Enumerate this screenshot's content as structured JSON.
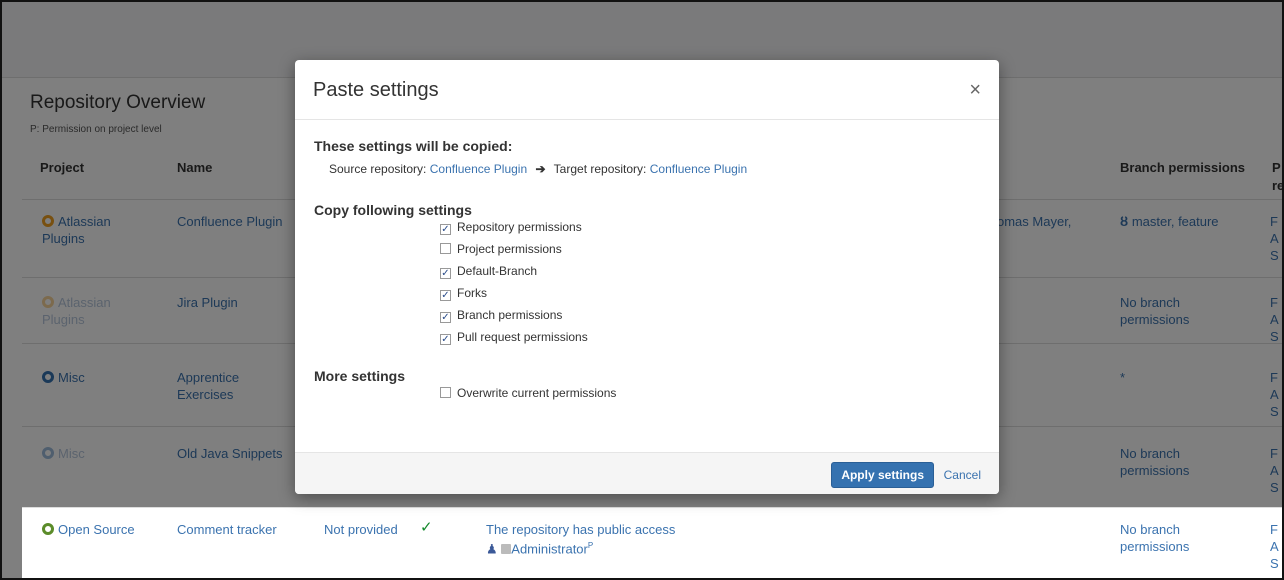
{
  "overview": {
    "title": "Repository Overview",
    "subtitle": "P: Permission on project level"
  },
  "table": {
    "headers": {
      "project": "Project",
      "name": "Name",
      "branch_permissions": "Branch permissions",
      "last_partial": "P",
      "last_partial2": "re"
    },
    "rows": [
      {
        "project": "Atlassian Plugins",
        "name": "Confluence Plugin",
        "users_partial": "omas Mayer,",
        "branch": "master, feature",
        "last": "F A S"
      },
      {
        "project": "Atlassian Plugins",
        "name": "Jira Plugin",
        "branch": "No branch permissions",
        "last": "F A S"
      },
      {
        "project": "Misc",
        "name": "Apprentice Exercises",
        "branch": "*",
        "last": "F A S"
      },
      {
        "project": "Misc",
        "name": "Old Java Snippets",
        "branch": "No branch permissions",
        "last": "F A S"
      },
      {
        "project": "Open Source",
        "name": "Comment tracker",
        "desc": "Not provided",
        "check": "✓",
        "access": "The repository has public access",
        "admin": "Administrator",
        "admin_sup": "P",
        "branch": "No branch permissions",
        "last": "F A S"
      }
    ]
  },
  "modal": {
    "title": "Paste settings",
    "close": "×",
    "copied_heading": "These settings will be copied:",
    "source_label": "Source repository:",
    "source_value": "Confluence Plugin",
    "target_label": "Target repository:",
    "target_value": "Confluence Plugin",
    "copy_heading": "Copy following settings",
    "options": [
      {
        "label": "Repository permissions",
        "checked": true
      },
      {
        "label": "Project permissions",
        "checked": false
      },
      {
        "label": "Default-Branch",
        "checked": true
      },
      {
        "label": "Forks",
        "checked": true
      },
      {
        "label": "Branch permissions",
        "checked": true
      },
      {
        "label": "Pull request permissions",
        "checked": true
      }
    ],
    "more_heading": "More settings",
    "more_options": [
      {
        "label": "Overwrite current permissions",
        "checked": false
      }
    ],
    "apply_label": "Apply settings",
    "cancel_label": "Cancel"
  },
  "colors": {
    "link": "#3b73af",
    "primary_button": "#3572b0",
    "project_orange": "#f0a020",
    "project_blue": "#3572b0",
    "project_green": "#5b8c2a",
    "check_green": "#14892c"
  }
}
